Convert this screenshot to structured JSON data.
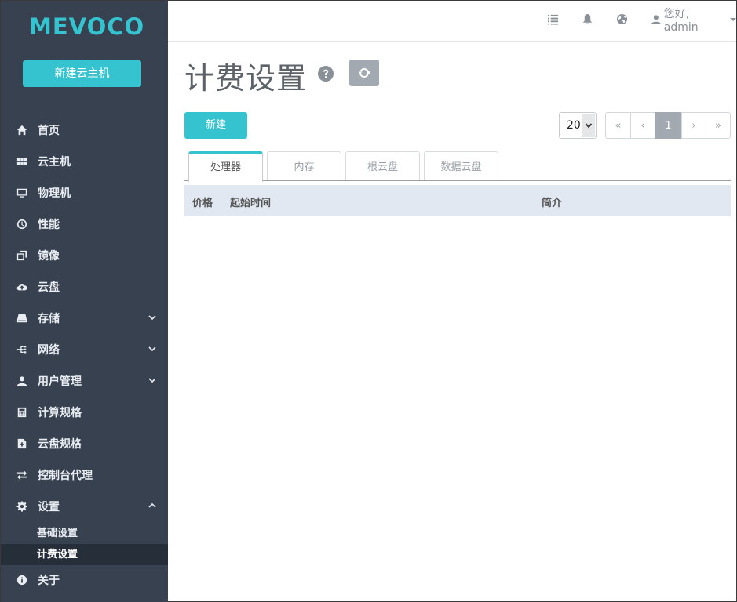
{
  "app": {
    "logo": "MEVOCO",
    "new_vm_button": "新建云主机"
  },
  "sidebar": {
    "items": [
      {
        "label": "首页",
        "icon": "home-icon"
      },
      {
        "label": "云主机",
        "icon": "grid-icon"
      },
      {
        "label": "物理机",
        "icon": "monitor-icon"
      },
      {
        "label": "性能",
        "icon": "dashboard-icon"
      },
      {
        "label": "镜像",
        "icon": "copy-icon"
      },
      {
        "label": "云盘",
        "icon": "cloud-upload-icon"
      },
      {
        "label": "存储",
        "icon": "hdd-icon"
      },
      {
        "label": "网络",
        "icon": "network-icon"
      },
      {
        "label": "用户管理",
        "icon": "user-icon"
      },
      {
        "label": "计算规格",
        "icon": "calculator-icon"
      },
      {
        "label": "云盘规格",
        "icon": "file-plus-icon"
      },
      {
        "label": "控制台代理",
        "icon": "exchange-icon"
      },
      {
        "label": "设置",
        "icon": "gear-icon"
      }
    ],
    "settings_children": [
      {
        "label": "基础设置"
      },
      {
        "label": "计费设置"
      }
    ],
    "about": {
      "label": "关于",
      "icon": "info-icon"
    }
  },
  "topbar": {
    "user_greeting": "您好, admin"
  },
  "main": {
    "title": "计费设置",
    "create_button": "新建",
    "page_size": "20",
    "pager": {
      "first": "«",
      "prev": "‹",
      "current": "1",
      "next": "›",
      "last": "»"
    },
    "tabs": [
      {
        "label": "处理器"
      },
      {
        "label": "内存"
      },
      {
        "label": "根云盘"
      },
      {
        "label": "数据云盘"
      }
    ],
    "table_columns": [
      "价格",
      "起始时间",
      "简介"
    ]
  },
  "colors": {
    "accent": "#35c3cf",
    "sidebar_bg": "#374150",
    "table_header_bg": "#e2e8f2"
  }
}
